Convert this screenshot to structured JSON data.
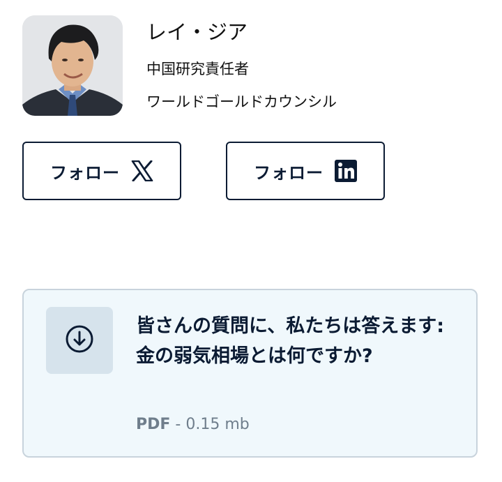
{
  "author": {
    "name": "レイ・ジア",
    "role": "中国研究責任者",
    "organization": "ワールドゴールドカウンシル"
  },
  "follow_buttons": [
    {
      "label": "フォロー",
      "icon": "x-logo-icon"
    },
    {
      "label": "フォロー",
      "icon": "linkedin-logo-icon"
    }
  ],
  "download": {
    "icon": "download-circle-icon",
    "title": "皆さんの質問に、私たちは答えます: 金の弱気相場とは何ですか?",
    "file_type": "PDF",
    "separator": " - ",
    "file_size": "0.15 mb"
  },
  "colors": {
    "navy": "#0b1b33",
    "card_bg": "#f0f8fc",
    "card_border": "#c8d3dc",
    "icon_box_bg": "#d6e3ec",
    "meta_gray": "#6f7e8c"
  }
}
